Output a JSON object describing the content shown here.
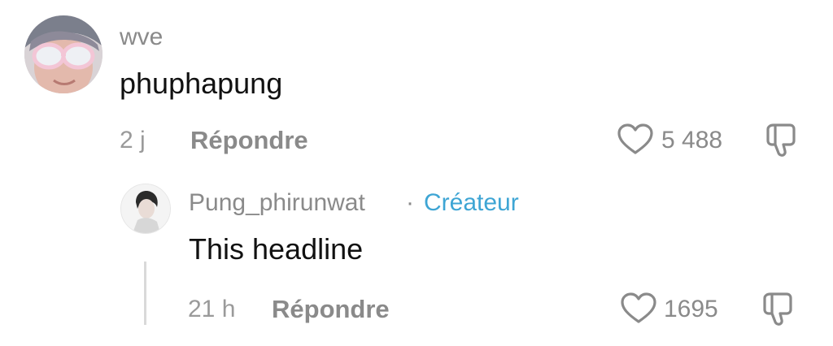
{
  "comment": {
    "username": "wve",
    "text": "phuphapung",
    "time": "2 j",
    "reply_label": "Répondre",
    "likes": "5 488"
  },
  "reply": {
    "username": "Pung_phirunwat",
    "separator": "·",
    "creator_badge": "Créateur",
    "text": "This headline",
    "time": "21 h",
    "reply_label": "Répondre",
    "likes": "1695"
  },
  "colors": {
    "creator_accent": "#3ea5d4",
    "muted_text": "#8a8a8a"
  },
  "icons": [
    "heart-icon",
    "dislike-icon"
  ]
}
